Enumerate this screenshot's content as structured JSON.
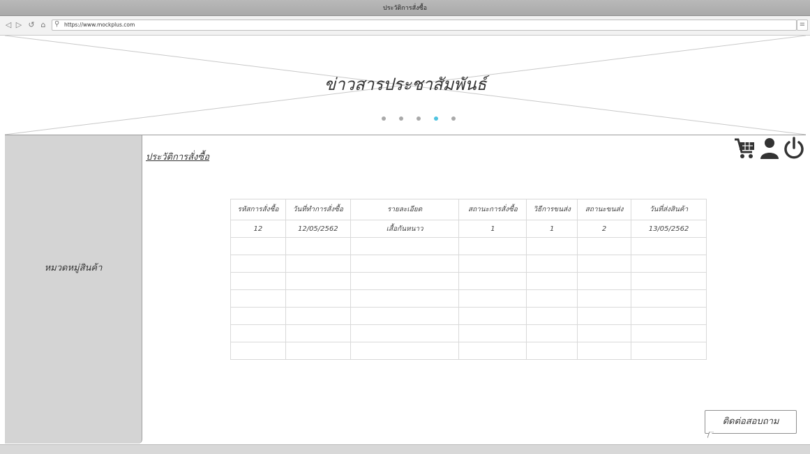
{
  "window": {
    "title": "ประวัติการสั่งซื้อ"
  },
  "browser": {
    "url": "https://www.mockplus.com"
  },
  "banner": {
    "headline": "ข่าวสารประชาสัมพันธ์",
    "slide_count": 5,
    "active_slide": 4,
    "active_color": "#4fc3e0"
  },
  "sidebar": {
    "label": "หมวดหมู่สินค้า"
  },
  "page": {
    "link": "ประวัติการสั่งซื้อ"
  },
  "table": {
    "headers": [
      "รหัสการสั่งซื้อ",
      "วันที่ทำการสั่งซื้อ",
      "รายละเอียด",
      "สถานะการสั่งซื้อ",
      "วิธีการขนส่ง",
      "สถานะขนส่ง",
      "วันที่ส่งสินค้า"
    ],
    "rows": [
      [
        "12",
        "12/05/2562",
        "เสื้อกันหนาว",
        "1",
        "1",
        "2",
        "13/05/2562"
      ],
      [
        "",
        "",
        "",
        "",
        "",
        "",
        ""
      ],
      [
        "",
        "",
        "",
        "",
        "",
        "",
        ""
      ],
      [
        "",
        "",
        "",
        "",
        "",
        "",
        ""
      ],
      [
        "",
        "",
        "",
        "",
        "",
        "",
        ""
      ],
      [
        "",
        "",
        "",
        "",
        "",
        "",
        ""
      ],
      [
        "",
        "",
        "",
        "",
        "",
        "",
        ""
      ],
      [
        "",
        "",
        "",
        "",
        "",
        "",
        ""
      ]
    ]
  },
  "icons": {
    "cart": "cart-icon",
    "user": "user-icon",
    "power": "power-icon"
  },
  "contact": {
    "label": "ติดต่อสอบถาม"
  }
}
